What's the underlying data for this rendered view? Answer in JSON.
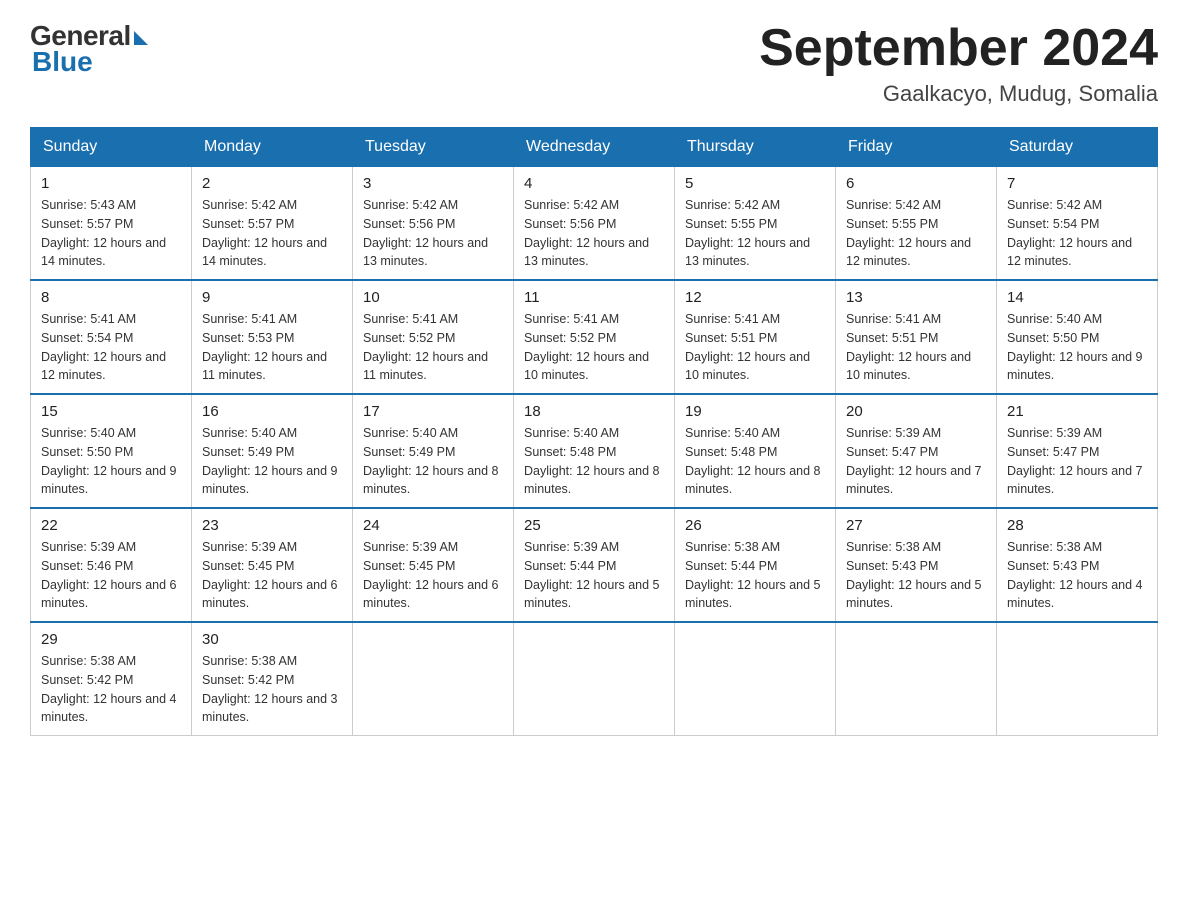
{
  "header": {
    "logo_general": "General",
    "logo_blue": "Blue",
    "month_title": "September 2024",
    "location": "Gaalkacyo, Mudug, Somalia"
  },
  "days_of_week": [
    "Sunday",
    "Monday",
    "Tuesday",
    "Wednesday",
    "Thursday",
    "Friday",
    "Saturday"
  ],
  "weeks": [
    [
      {
        "day": "1",
        "sunrise": "5:43 AM",
        "sunset": "5:57 PM",
        "daylight": "12 hours and 14 minutes."
      },
      {
        "day": "2",
        "sunrise": "5:42 AM",
        "sunset": "5:57 PM",
        "daylight": "12 hours and 14 minutes."
      },
      {
        "day": "3",
        "sunrise": "5:42 AM",
        "sunset": "5:56 PM",
        "daylight": "12 hours and 13 minutes."
      },
      {
        "day": "4",
        "sunrise": "5:42 AM",
        "sunset": "5:56 PM",
        "daylight": "12 hours and 13 minutes."
      },
      {
        "day": "5",
        "sunrise": "5:42 AM",
        "sunset": "5:55 PM",
        "daylight": "12 hours and 13 minutes."
      },
      {
        "day": "6",
        "sunrise": "5:42 AM",
        "sunset": "5:55 PM",
        "daylight": "12 hours and 12 minutes."
      },
      {
        "day": "7",
        "sunrise": "5:42 AM",
        "sunset": "5:54 PM",
        "daylight": "12 hours and 12 minutes."
      }
    ],
    [
      {
        "day": "8",
        "sunrise": "5:41 AM",
        "sunset": "5:54 PM",
        "daylight": "12 hours and 12 minutes."
      },
      {
        "day": "9",
        "sunrise": "5:41 AM",
        "sunset": "5:53 PM",
        "daylight": "12 hours and 11 minutes."
      },
      {
        "day": "10",
        "sunrise": "5:41 AM",
        "sunset": "5:52 PM",
        "daylight": "12 hours and 11 minutes."
      },
      {
        "day": "11",
        "sunrise": "5:41 AM",
        "sunset": "5:52 PM",
        "daylight": "12 hours and 10 minutes."
      },
      {
        "day": "12",
        "sunrise": "5:41 AM",
        "sunset": "5:51 PM",
        "daylight": "12 hours and 10 minutes."
      },
      {
        "day": "13",
        "sunrise": "5:41 AM",
        "sunset": "5:51 PM",
        "daylight": "12 hours and 10 minutes."
      },
      {
        "day": "14",
        "sunrise": "5:40 AM",
        "sunset": "5:50 PM",
        "daylight": "12 hours and 9 minutes."
      }
    ],
    [
      {
        "day": "15",
        "sunrise": "5:40 AM",
        "sunset": "5:50 PM",
        "daylight": "12 hours and 9 minutes."
      },
      {
        "day": "16",
        "sunrise": "5:40 AM",
        "sunset": "5:49 PM",
        "daylight": "12 hours and 9 minutes."
      },
      {
        "day": "17",
        "sunrise": "5:40 AM",
        "sunset": "5:49 PM",
        "daylight": "12 hours and 8 minutes."
      },
      {
        "day": "18",
        "sunrise": "5:40 AM",
        "sunset": "5:48 PM",
        "daylight": "12 hours and 8 minutes."
      },
      {
        "day": "19",
        "sunrise": "5:40 AM",
        "sunset": "5:48 PM",
        "daylight": "12 hours and 8 minutes."
      },
      {
        "day": "20",
        "sunrise": "5:39 AM",
        "sunset": "5:47 PM",
        "daylight": "12 hours and 7 minutes."
      },
      {
        "day": "21",
        "sunrise": "5:39 AM",
        "sunset": "5:47 PM",
        "daylight": "12 hours and 7 minutes."
      }
    ],
    [
      {
        "day": "22",
        "sunrise": "5:39 AM",
        "sunset": "5:46 PM",
        "daylight": "12 hours and 6 minutes."
      },
      {
        "day": "23",
        "sunrise": "5:39 AM",
        "sunset": "5:45 PM",
        "daylight": "12 hours and 6 minutes."
      },
      {
        "day": "24",
        "sunrise": "5:39 AM",
        "sunset": "5:45 PM",
        "daylight": "12 hours and 6 minutes."
      },
      {
        "day": "25",
        "sunrise": "5:39 AM",
        "sunset": "5:44 PM",
        "daylight": "12 hours and 5 minutes."
      },
      {
        "day": "26",
        "sunrise": "5:38 AM",
        "sunset": "5:44 PM",
        "daylight": "12 hours and 5 minutes."
      },
      {
        "day": "27",
        "sunrise": "5:38 AM",
        "sunset": "5:43 PM",
        "daylight": "12 hours and 5 minutes."
      },
      {
        "day": "28",
        "sunrise": "5:38 AM",
        "sunset": "5:43 PM",
        "daylight": "12 hours and 4 minutes."
      }
    ],
    [
      {
        "day": "29",
        "sunrise": "5:38 AM",
        "sunset": "5:42 PM",
        "daylight": "12 hours and 4 minutes."
      },
      {
        "day": "30",
        "sunrise": "5:38 AM",
        "sunset": "5:42 PM",
        "daylight": "12 hours and 3 minutes."
      },
      null,
      null,
      null,
      null,
      null
    ]
  ]
}
